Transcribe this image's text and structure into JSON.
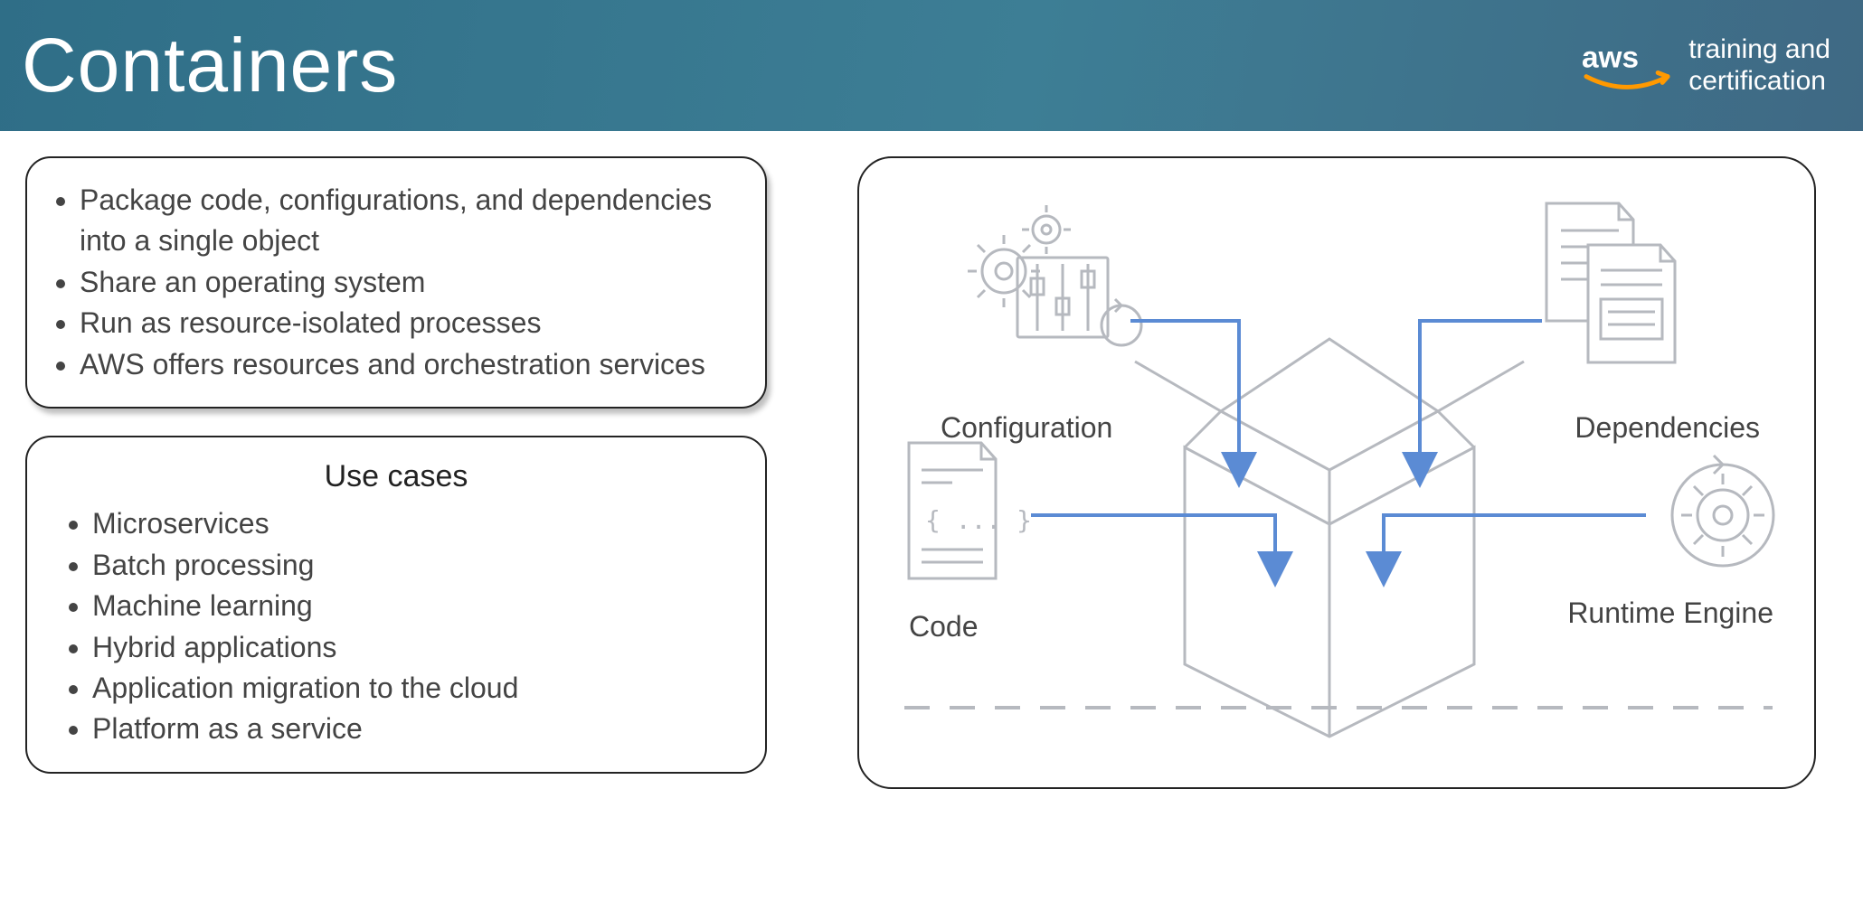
{
  "header": {
    "title": "Containers",
    "brand_line1": "training and",
    "brand_line2": "certification"
  },
  "left_panel": {
    "items": [
      "Package code, configurations, and dependencies into a single object",
      "Share an operating system",
      "Run as resource-isolated processes",
      "AWS offers resources and orchestration services"
    ]
  },
  "use_cases": {
    "title": "Use cases",
    "items": [
      "Microservices",
      "Batch processing",
      "Machine learning",
      "Hybrid applications",
      "Application migration to the cloud",
      "Platform as a service"
    ]
  },
  "diagram": {
    "labels": {
      "configuration": "Configuration",
      "dependencies": "Dependencies",
      "code": "Code",
      "runtime_engine": "Runtime Engine"
    }
  }
}
